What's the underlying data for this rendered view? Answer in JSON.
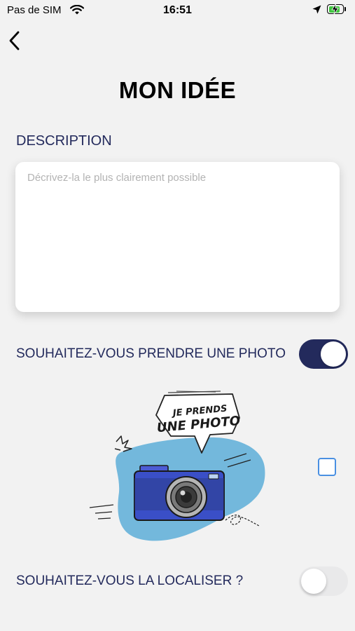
{
  "status_bar": {
    "carrier": "Pas de SIM",
    "time": "16:51",
    "battery_level": 0.75
  },
  "header": {
    "title": "MON IDÉE"
  },
  "description": {
    "label": "DESCRIPTION",
    "placeholder": "Décrivez-la le plus clairement possible",
    "value": ""
  },
  "photo": {
    "label": "SOUHAITEZ-VOUS PRENDRE UNE PHOTO",
    "enabled": true,
    "illustration_line1": "JE PRENDS",
    "illustration_line2": "UNE PHOTO",
    "checkbox_checked": false
  },
  "location": {
    "label": "SOUHAITEZ-VOUS LA LOCALISER ?",
    "enabled": false
  },
  "colors": {
    "navy": "#232a5c",
    "toggle_off": "#e9e9ea",
    "checkbox_blue": "#4a90e2",
    "blob_blue": "#73b8dc",
    "camera_blue": "#3a4fc7"
  }
}
